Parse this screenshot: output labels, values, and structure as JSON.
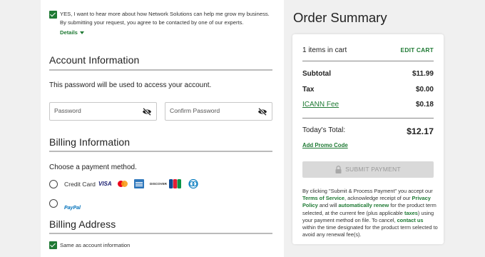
{
  "optin": {
    "line1": "YES, I want to hear more about how Network Solutions can help me grow my business.",
    "line2": "By submitting your request, you agree to be contacted by one of our experts.",
    "details": "Details"
  },
  "account": {
    "title": "Account Information",
    "desc": "This password will be used to access your account.",
    "password_placeholder": "Password",
    "confirm_placeholder": "Confirm Password"
  },
  "billing": {
    "title": "Billing Information",
    "choose": "Choose a payment method.",
    "credit_card": "Credit Card",
    "card_logos": [
      "visa-logo",
      "mastercard-logo",
      "amex-logo",
      "discover-logo",
      "jcb-logo",
      "diners-logo"
    ],
    "visa_text": "VISA",
    "discover_text": "DISCOVER",
    "paypal_text": "PayPal"
  },
  "address": {
    "title": "Billing Address",
    "same_as": "Same as account information"
  },
  "summary": {
    "title": "Order Summary",
    "items_in_cart": "1 items in cart",
    "edit_cart": "EDIT CART",
    "subtotal_label": "Subtotal",
    "subtotal_value": "$11.99",
    "tax_label": "Tax",
    "tax_value": "$0.00",
    "icann_label": "ICANN Fee",
    "icann_value": "$0.18",
    "total_label": "Today's Total:",
    "total_value": "$12.17",
    "promo": "Add Promo Code",
    "submit": "SUBMIT PAYMENT",
    "legal": {
      "p1": "By clicking \"Submit & Process Payment\" you accept our ",
      "terms": "Terms of Service",
      "p2": ", acknowledge receipt of our ",
      "privacy": "Privacy Policy",
      "p3": " and will ",
      "renew": "automatically renew",
      "p4": " for the product term selected, at the current fee (plus applicable ",
      "taxes": "taxes",
      "p5": ") using your payment method on file. To cancel, ",
      "contact": "contact us",
      "p6": " within the time designated for the product term selected to avoid any renewal fee(s)."
    }
  },
  "colors": {
    "brand_green": "#1f7a34",
    "disabled": "#d9d9d9"
  }
}
